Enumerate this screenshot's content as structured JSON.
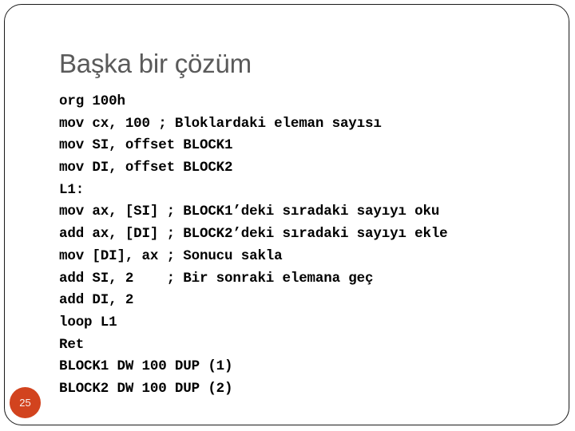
{
  "slide": {
    "title": "Başka bir çözüm",
    "number": "25",
    "accent_color": "#d2431e",
    "title_color": "#5a5a5a",
    "border_color": "#1a1a1a",
    "background_color": "#ffffff",
    "code_color": "#000000",
    "code_lines": [
      "org 100h",
      "mov cx, 100 ; Bloklardaki eleman sayısı",
      "mov SI, offset BLOCK1",
      "mov DI, offset BLOCK2",
      "L1:",
      "mov ax, [SI] ; BLOCK1’deki sıradaki sayıyı oku",
      "add ax, [DI] ; BLOCK2’deki sıradaki sayıyı ekle",
      "mov [DI], ax ; Sonucu sakla",
      "add SI, 2    ; Bir sonraki elemana geç",
      "add DI, 2",
      "loop L1",
      "Ret",
      "BLOCK1 DW 100 DUP (1)",
      "BLOCK2 DW 100 DUP (2)"
    ]
  }
}
